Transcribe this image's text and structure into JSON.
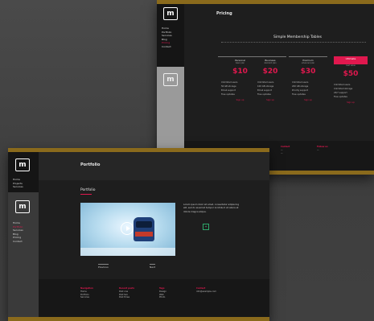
{
  "back_window": {
    "title": "Pricing",
    "heading": "Simple Membership Tables",
    "nav": [
      "Home",
      "Portfolio",
      "Services",
      "Blog",
      "Pricing",
      "Contact"
    ],
    "active_nav": 4,
    "plans": [
      {
        "name": "Personal",
        "sub": "basic plan",
        "price": "$10",
        "features": [
          "Unlimited users",
          "50 GB storage",
          "Email support",
          "Free updates"
        ],
        "button": "Sign up"
      },
      {
        "name": "Business",
        "sub": "standard plan",
        "price": "$20",
        "features": [
          "Unlimited users",
          "100 GB storage",
          "Email support",
          "Free updates"
        ],
        "button": "Sign up"
      },
      {
        "name": "Premium",
        "sub": "advanced plan",
        "price": "$30",
        "features": [
          "Unlimited users",
          "200 GB storage",
          "Priority support",
          "Free updates"
        ],
        "button": "Sign up"
      },
      {
        "name": "Ultimate",
        "sub": "best value",
        "price": "$50",
        "features": [
          "Unlimited users",
          "Unlimited storage",
          "24/7 support",
          "Free updates"
        ],
        "button": "Sign up"
      }
    ],
    "footer": [
      "Contact",
      "Follow us"
    ]
  },
  "front_window": {
    "title": "Portfolio",
    "section_title": "Portfolio",
    "nav": [
      "Home",
      "Portfolio",
      "Services",
      "Blog",
      "Pricing",
      "Contact"
    ],
    "nav_top": [
      "Home",
      "Projects",
      "Services"
    ],
    "active_nav": 1,
    "description": "Lorem ipsum dolor sit amet, consectetur adipiscing elit, sed do eiusmod tempor incididunt ut labore et dolore magna aliqua.",
    "thumb_labels": [
      "Previous",
      "Next"
    ],
    "footer_cols": [
      {
        "heading": "Navigation",
        "items": [
          "Home",
          "Portfolio",
          "Services"
        ]
      },
      {
        "heading": "Recent posts",
        "items": [
          "Post one",
          "Post two",
          "Post three"
        ]
      },
      {
        "heading": "Tags",
        "items": [
          "Design",
          "Web",
          "Photo"
        ]
      },
      {
        "heading": "Contact",
        "items": [
          "info@example.com"
        ]
      }
    ]
  },
  "colors": {
    "accent": "#e0184e",
    "gold": "#8a6a1c"
  }
}
